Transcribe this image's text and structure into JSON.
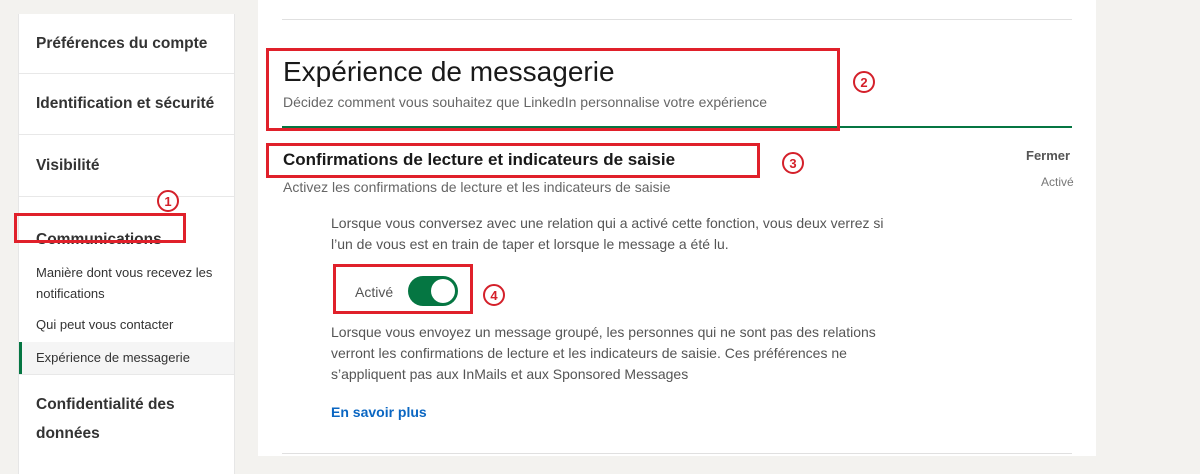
{
  "sidebar": {
    "sections": [
      {
        "label": "Préférences du compte"
      },
      {
        "label": "Identification et sécurité"
      },
      {
        "label": "Visibilité"
      },
      {
        "label": "Communications"
      }
    ],
    "sub_items": [
      {
        "label": "Manière dont vous recevez les notifications"
      },
      {
        "label": "Qui peut vous contacter"
      },
      {
        "label": "Expérience de messagerie"
      }
    ],
    "privacy_label": "Confidentialité des données"
  },
  "main": {
    "title": "Expérience de messagerie",
    "subtitle": "Décidez comment vous souhaitez que LinkedIn personnalise votre expérience",
    "setting": {
      "title": "Confirmations de lecture et indicateurs de saisie",
      "description": "Activez les confirmations de lecture et les indicateurs de saisie",
      "close_label": "Fermer",
      "status_label": "Activé",
      "info_text": "Lorsque vous conversez avec une relation qui a activé cette fonction, vous deux verrez si l’un de vous est en train de taper et lorsque le message a été lu.",
      "toggle_label": "Activé",
      "toggle_on": true,
      "note_text": "Lorsque vous envoyez un message groupé, les personnes qui ne sont pas des relations verront les confirmations de lecture et les indicateurs de saisie. Ces préférences ne s’appliquent pas aux InMails et aux Sponsored Messages",
      "learn_more": "En savoir plus"
    }
  },
  "annotations": [
    "1",
    "2",
    "3",
    "4"
  ],
  "colors": {
    "accent_green": "#057642",
    "link_blue": "#0a66c2",
    "annotation_red": "#e0202a",
    "page_bg": "#f3f2ef"
  }
}
